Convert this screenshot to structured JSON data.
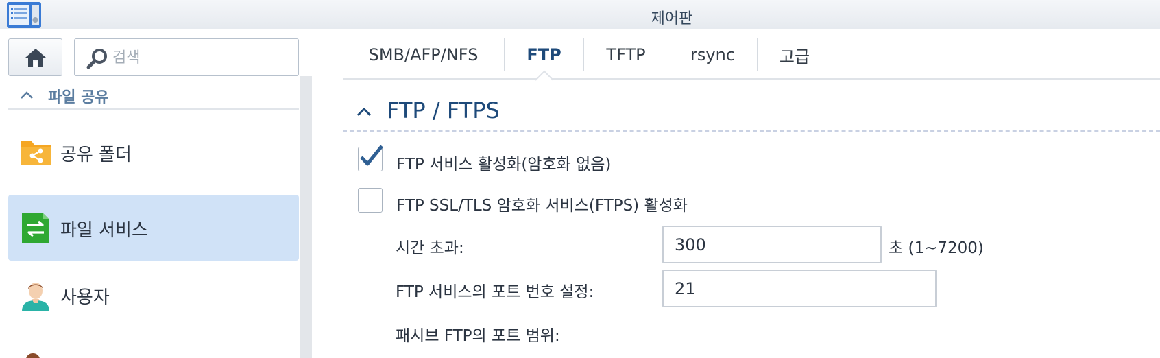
{
  "window": {
    "title": "제어판",
    "icon": "control-panel-icon"
  },
  "sidebar": {
    "home_icon": "home-icon",
    "search": {
      "placeholder": "검색",
      "value": "",
      "icon": "search-icon"
    },
    "section": {
      "label": "파일 공유",
      "expanded": true
    },
    "items": [
      {
        "label": "공유 폴더",
        "icon": "shared-folder-icon",
        "active": false
      },
      {
        "label": "파일 서비스",
        "icon": "file-services-icon",
        "active": true
      },
      {
        "label": "사용자",
        "icon": "user-icon",
        "active": false
      }
    ]
  },
  "tabs": [
    {
      "label": "SMB/AFP/NFS",
      "active": false
    },
    {
      "label": "FTP",
      "active": true
    },
    {
      "label": "TFTP",
      "active": false
    },
    {
      "label": "rsync",
      "active": false
    },
    {
      "label": "고급",
      "active": false
    }
  ],
  "ftp": {
    "section_title": "FTP / FTPS",
    "enable_ftp": {
      "label": "FTP 서비스 활성화(암호화 없음)",
      "checked": true
    },
    "enable_ftps": {
      "label": "FTP SSL/TLS 암호화 서비스(FTPS) 활성화",
      "checked": false
    },
    "timeout": {
      "label": "시간 초과:",
      "value": "300",
      "unit": "초 (1~7200)"
    },
    "port": {
      "label": "FTP 서비스의 포트 번호 설정:",
      "value": "21"
    },
    "passive_range": {
      "label": "패시브 FTP의 포트 범위:"
    }
  },
  "colors": {
    "accent": "#1e4a7a",
    "active_bg": "#d0e2f7",
    "check": "#2f5f93"
  }
}
